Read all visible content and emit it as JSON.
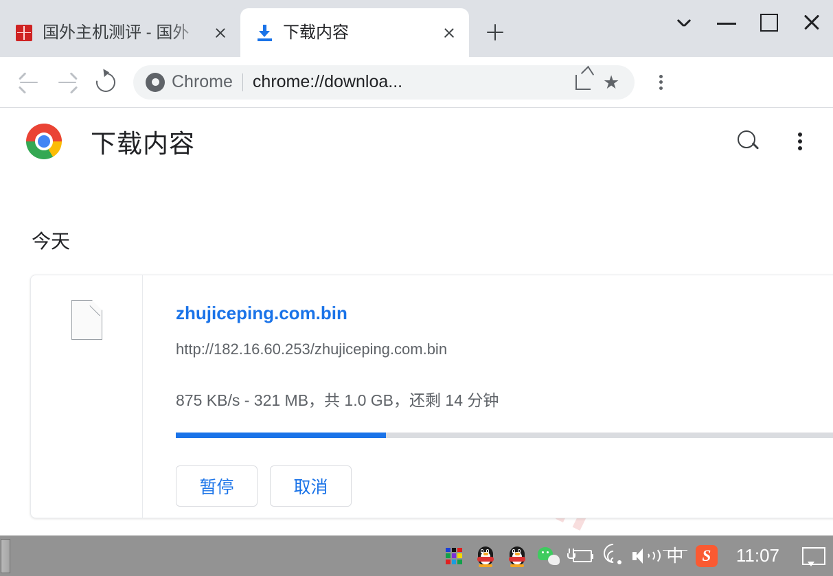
{
  "window": {
    "controls": [
      {
        "name": "tab-search",
        "glyph": "chevron-down"
      },
      {
        "name": "minimize",
        "glyph": "minus"
      },
      {
        "name": "maximize",
        "glyph": "square"
      },
      {
        "name": "close",
        "glyph": "x"
      }
    ]
  },
  "tabs": [
    {
      "title": "国外主机测评 - 国外",
      "favicon": "red-seal-icon",
      "active": false,
      "close_label": "×"
    },
    {
      "title": "下载内容",
      "favicon": "download-arrow-icon",
      "active": true,
      "close_label": "×"
    }
  ],
  "newtab": {
    "tooltip": "新标签页",
    "glyph": "+"
  },
  "toolbar": {
    "back": "back-arrow-icon",
    "forward": "forward-arrow-icon",
    "reload": "reload-icon",
    "omnibox": {
      "brand": "Chrome",
      "url": "chrome://downloa...",
      "share": "share-icon",
      "bookmark": "★"
    },
    "menu": "three-dots-icon"
  },
  "downloads_page": {
    "title": "下载内容",
    "logo": "chrome-logo",
    "search_label": "搜索下载内容",
    "menu_label": "更多操作",
    "section_label": "今天",
    "watermark": "zhujiceping.com",
    "item": {
      "file_icon": "generic-file-icon",
      "file_name": "zhujiceping.com.bin",
      "source_url": "http://182.16.60.253/zhujiceping.com.bin",
      "status": "875 KB/s - 321 MB，共 1.0 GB，还剩 14 分钟",
      "speed": "875 KB/s",
      "downloaded": "321 MB",
      "total_size": "1.0 GB",
      "time_remaining": "14 分钟",
      "progress_percent": 32,
      "progress_color": "#1a73e8",
      "buttons": [
        {
          "label": "暂停",
          "name": "pause-download-button"
        },
        {
          "label": "取消",
          "name": "cancel-download-button"
        }
      ]
    }
  },
  "taskbar": {
    "tray_icons": [
      {
        "name": "color-grid-icon"
      },
      {
        "name": "qq-icon-1"
      },
      {
        "name": "qq-icon-2"
      },
      {
        "name": "wechat-icon"
      },
      {
        "name": "battery-charging-icon"
      },
      {
        "name": "wifi-icon"
      },
      {
        "name": "volume-icon"
      },
      {
        "name": "ime-chinese-icon",
        "glyph": "中"
      },
      {
        "name": "sogou-icon",
        "glyph": "S"
      }
    ],
    "clock": "11:07",
    "notification": "notification-icon"
  },
  "colors": {
    "accent": "#1a73e8",
    "tabstrip": "#dee1e6",
    "taskbar": "#939393",
    "link": "#1a73e8",
    "muted_text": "#5f6368",
    "watermark": "#f8dede"
  }
}
